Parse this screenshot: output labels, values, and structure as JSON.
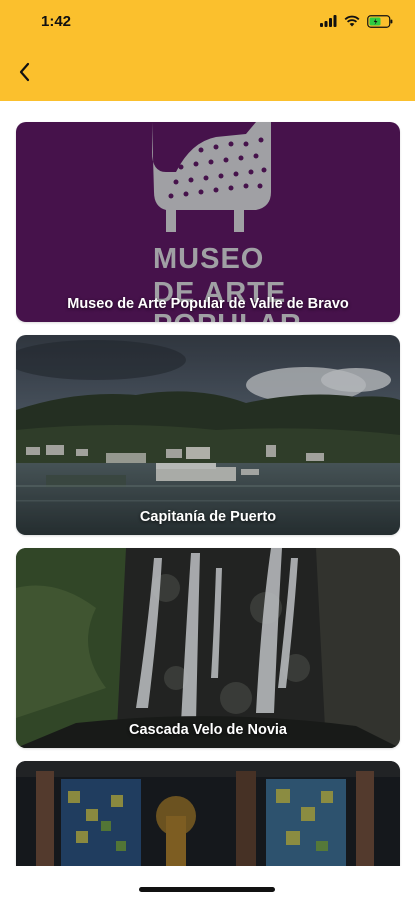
{
  "status_bar": {
    "time": "1:42"
  },
  "colors": {
    "header": "#fbc02d",
    "museum_bg": "#4a1450"
  },
  "header": {
    "back_icon": "chevron-left-icon"
  },
  "places": [
    {
      "title": "Museo de Arte Popular de Valle de Bravo",
      "image": "museum-logo-image",
      "logo_text": [
        "MUSEO",
        "DE ARTE",
        "POPULAR"
      ]
    },
    {
      "title": "Capitanía de Puerto",
      "image": "lake-harbor-photo"
    },
    {
      "title": "Cascada Velo de Novia",
      "image": "waterfall-photo"
    },
    {
      "title": "",
      "image": "stained-glass-church-photo"
    }
  ]
}
